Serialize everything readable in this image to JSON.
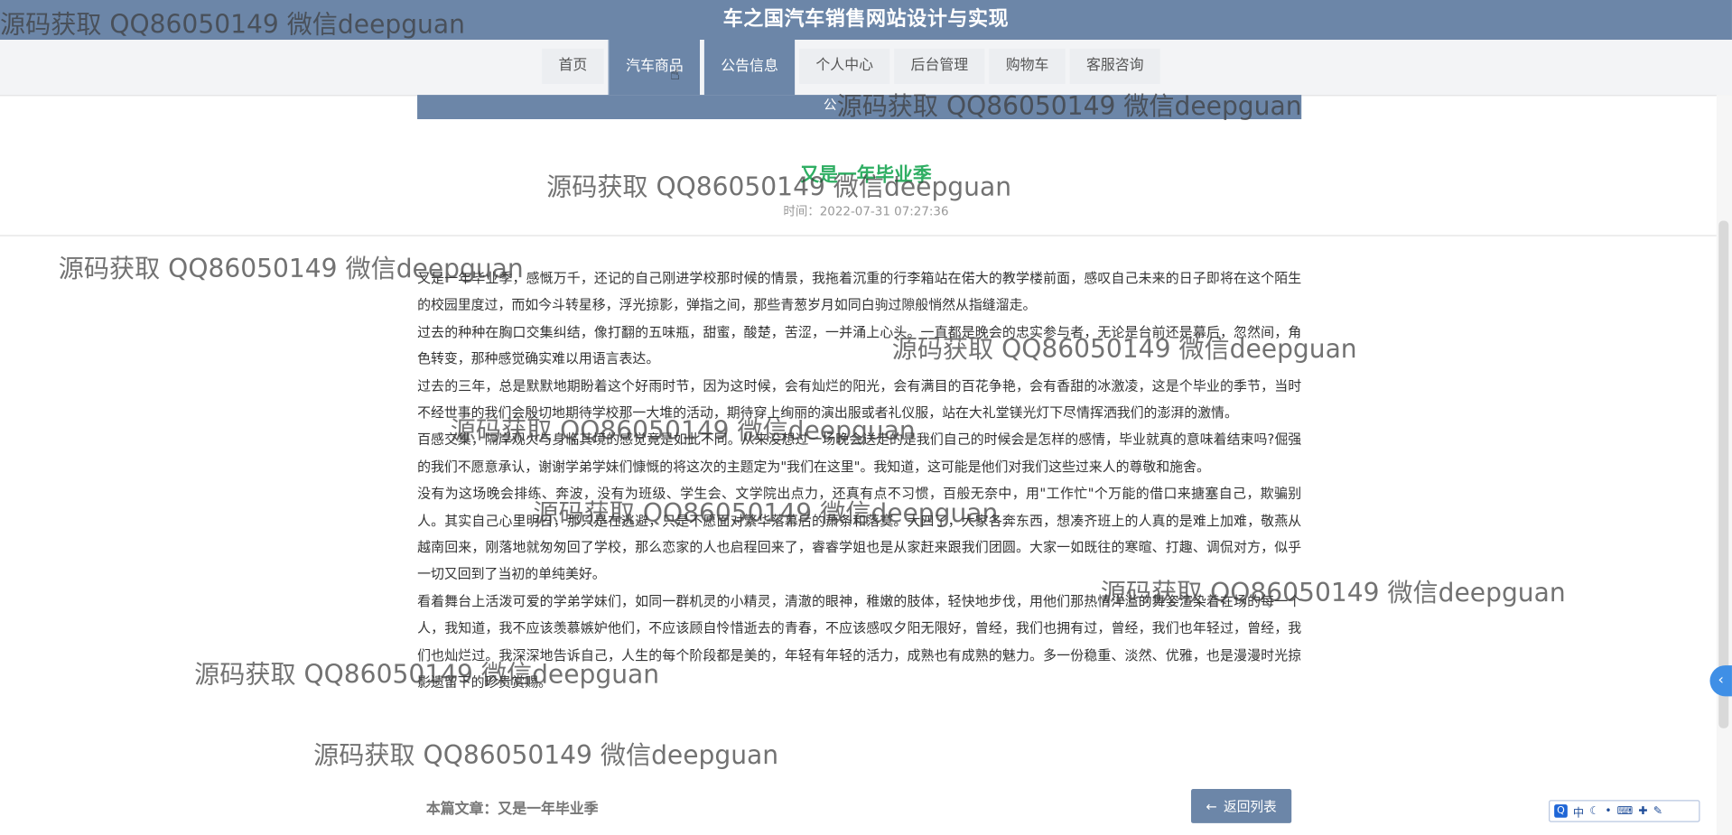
{
  "header": {
    "site_title": "车之国汽车销售网站设计与实现"
  },
  "nav": {
    "items": [
      {
        "label": "首页"
      },
      {
        "label": "汽车商品"
      },
      {
        "label": "公告信息"
      },
      {
        "label": "个人中心"
      },
      {
        "label": "后台管理"
      },
      {
        "label": "购物车"
      },
      {
        "label": "客服咨询"
      }
    ]
  },
  "banner": {
    "text": "公"
  },
  "article": {
    "title": "又是一年毕业季",
    "time": "时间：2022-07-31 07:27:36",
    "paragraphs": [
      "又是一年毕业季，感慨万千，还记的自己刚进学校那时候的情景，我拖着沉重的行李箱站在偌大的教学楼前面，感叹自己未来的日子即将在这个陌生的校园里度过，而如今斗转星移，浮光掠影，弹指之间，那些青葱岁月如同白驹过隙般悄然从指缝溜走。",
      "过去的种种在胸口交集纠结，像打翻的五味瓶，甜蜜，酸楚，苦涩，一并涌上心头。一直都是晚会的忠实参与者，无论是台前还是幕后，忽然间，角色转变，那种感觉确实难以用语言表达。",
      "过去的三年，总是默默地期盼着这个好雨时节，因为这时候，会有灿烂的阳光，会有满目的百花争艳，会有香甜的冰激凌，这是个毕业的季节，当时不经世事的我们会殷切地期待学校那一大堆的活动，期待穿上绚丽的演出服或者礼仪服，站在大礼堂镁光灯下尽情挥洒我们的澎湃的激情。",
      "百感交集，隔岸观火与身临其境的感觉竟是如此不同。从来没想过一场晚会送走的是我们自己的时候会是怎样的感情，毕业就真的意味着结束吗?倔强的我们不愿意承认，谢谢学弟学妹们慷慨的将这次的主题定为\"我们在这里\"。我知道，这可能是他们对我们这些过来人的尊敬和施舍。",
      "没有为这场晚会排练、奔波，没有为班级、学生会、文学院出点力，还真有点不习惯，百般无奈中，用\"工作忙\"个万能的借口来搪塞自己，欺骗别人。其实自己心里明日，那只是在逃避，只是不愿面对繁华落幕后的萧条和落寞。大四了，大家各奔东西，想凑齐班上的人真的是难上加难，敬燕从越南回来，刚落地就匆匆回了学校，那么恋家的人也启程回来了，睿睿学姐也是从家赶来跟我们团圆。大家一如既往的寒暄、打趣、调侃对方，似乎一切又回到了当初的单纯美好。",
      "看着舞台上活泼可爱的学弟学妹们，如同一群机灵的小精灵，清澈的眼神，稚嫩的肢体，轻快地步伐，用他们那热情洋溢的舞姿渲染着在场的每一个人，我知道，我不应该羡慕嫉妒他们，不应该顾自怜惜逝去的青春，不应该感叹夕阳无限好，曾经，我们也拥有过，曾经，我们也年轻过，曾经，我们也灿烂过。我深深地告诉自己，人生的每个阶段都是美的，年轻有年轻的活力，成熟也有成熟的魅力。多一份稳重、淡然、优雅，也是漫漫时光掠影遗留下的珍贵赏赐。"
    ],
    "footer_label": "本篇文章：又是一年毕业季",
    "back_button": "返回列表"
  },
  "ime": {
    "logo": "Q",
    "mode": "中"
  },
  "watermark": {
    "text": "源码获取 QQ86050149 微信deepguan"
  },
  "colors": {
    "header_bg": "#6c86a8",
    "title_green": "#2fae63",
    "side_tab": "#3f8fe6"
  }
}
